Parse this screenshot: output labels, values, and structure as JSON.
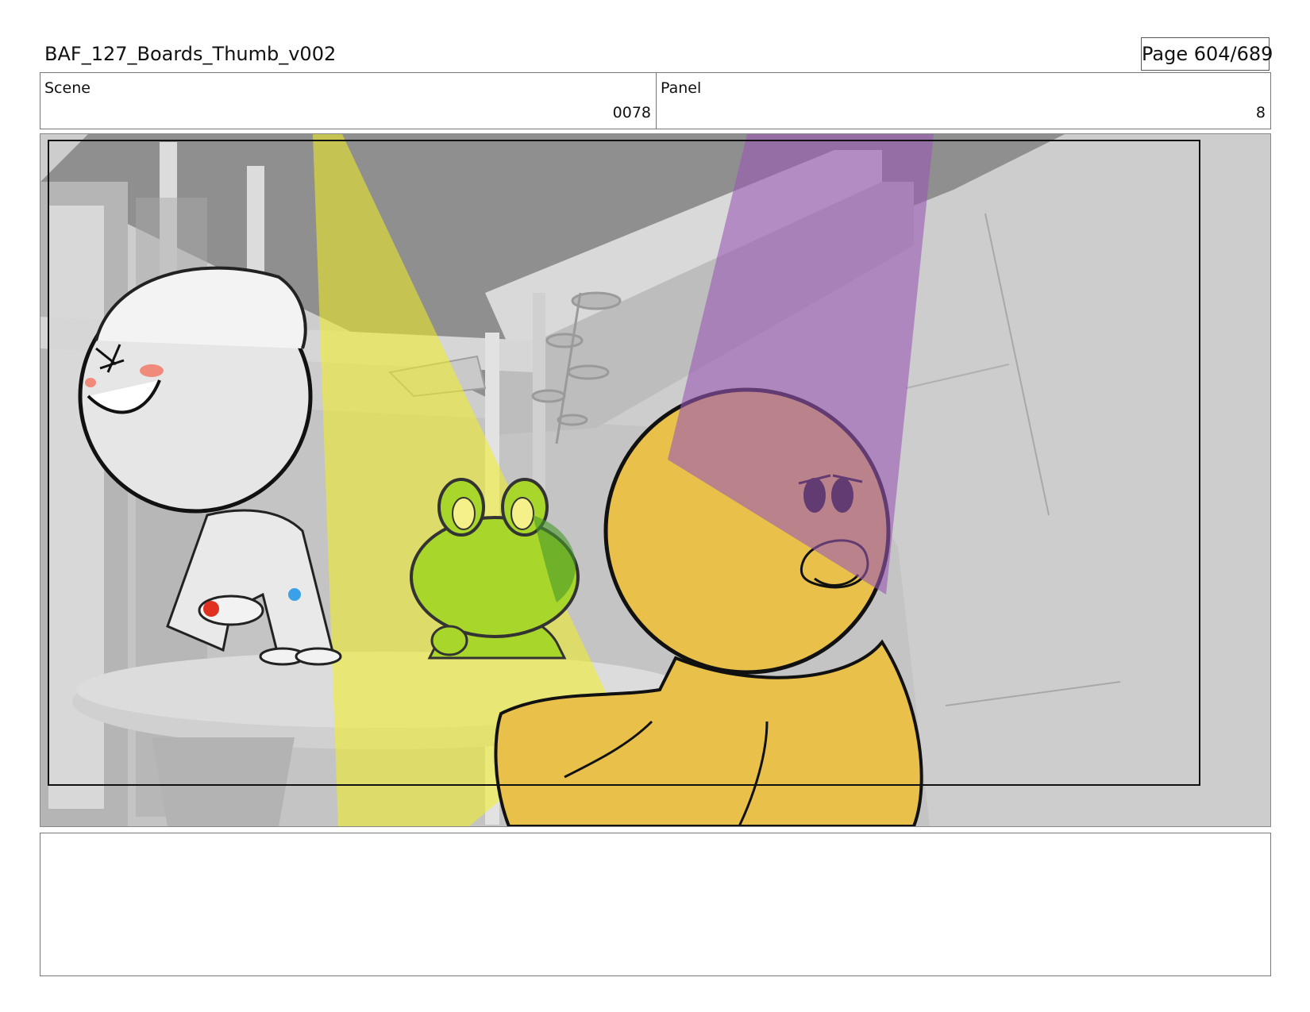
{
  "header": {
    "title": "BAF_127_Boards_Thumb_v002",
    "page_label": "Page 604/689"
  },
  "info": {
    "scene_label": "Scene",
    "scene_value": "0078",
    "panel_label": "Panel",
    "panel_value": "8"
  },
  "panel_image": {
    "characters": [
      "boy-character",
      "frog-character",
      "duck-character"
    ],
    "light_colors": {
      "yellow_spotlight": "#f2f020",
      "purple_spotlight": "#9b59b6"
    },
    "character_colors": {
      "frog": "#a8d62a",
      "duck": "#e8c04a",
      "blush": "#f08a7a"
    }
  },
  "notes": {
    "text": ""
  }
}
